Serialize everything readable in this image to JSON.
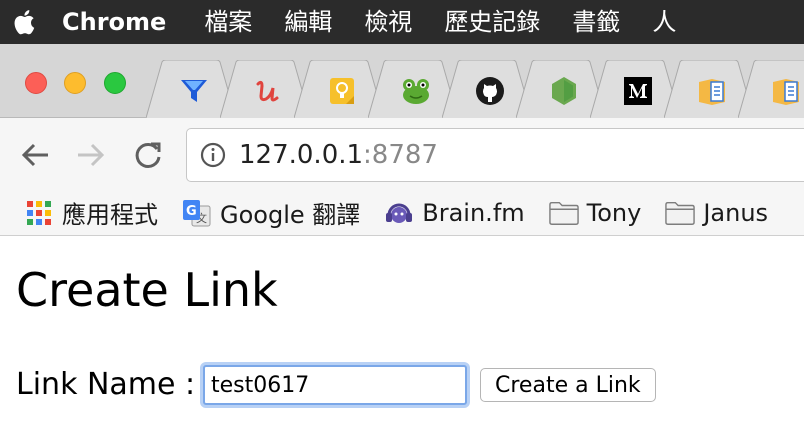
{
  "menubar": {
    "app_name": "Chrome",
    "items": [
      "檔案",
      "編輯",
      "檢視",
      "歷史記錄",
      "書籤",
      "人"
    ]
  },
  "tabs": [
    {
      "icon": "funnel-icon"
    },
    {
      "icon": "u-logo-icon"
    },
    {
      "icon": "lightbulb-icon"
    },
    {
      "icon": "frog-icon"
    },
    {
      "icon": "github-icon"
    },
    {
      "icon": "nodejs-icon"
    },
    {
      "icon": "medium-icon"
    },
    {
      "icon": "book-icon"
    },
    {
      "icon": "book-icon"
    }
  ],
  "toolbar": {
    "url_host": "127.0.0.1",
    "url_port": ":8787"
  },
  "bookmarks": [
    {
      "label": "應用程式",
      "icon": "apps-grid-icon"
    },
    {
      "label": "Google 翻譯",
      "icon": "google-translate-icon"
    },
    {
      "label": "Brain.fm",
      "icon": "brainfm-icon"
    },
    {
      "label": "Tony",
      "icon": "folder-icon"
    },
    {
      "label": "Janus",
      "icon": "folder-icon"
    }
  ],
  "page": {
    "title": "Create Link",
    "form_label": "Link Name :",
    "input_value": "test0617",
    "submit_label": "Create a Link"
  },
  "colors": {
    "menubar_bg": "#2b2b2b",
    "close": "#fc5f57",
    "minimize": "#fdbc2e",
    "maximize": "#2ac840",
    "focus_ring": "#7aa7e8"
  }
}
